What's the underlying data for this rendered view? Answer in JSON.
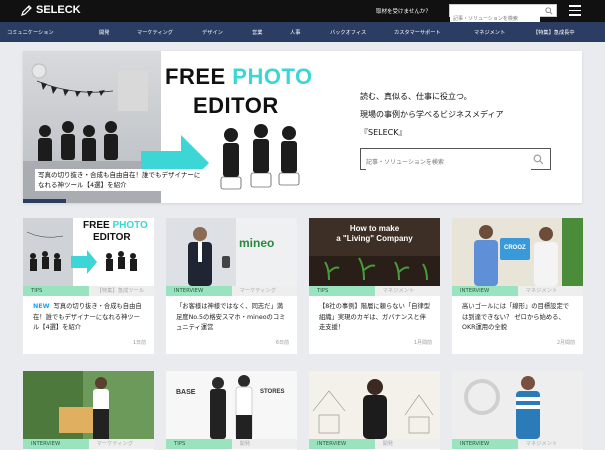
{
  "header": {
    "logo": "SELECK",
    "prompt": "取材を受けませんか？",
    "search_placeholder": "記事・ソリューションを検索"
  },
  "nav": {
    "items": [
      "コミュニケーション",
      "開発",
      "マーケティング",
      "デザイン",
      "営業",
      "人事",
      "バックオフィス",
      "カスタマーサポート",
      "マネジメント",
      "【特集】",
      "急成長中"
    ]
  },
  "hero": {
    "title_part1": "FREE ",
    "title_accent": "PHOTO",
    "title_line2": "EDITOR",
    "caption": "写真の切り抜き・合成も自由自在！誰でもデザイナーになれる神ツール【4選】を紹介",
    "tagline1": "読む、真似る、仕事に役立つ。",
    "tagline2": "現場の事例から学べるビジネスメディア",
    "tagline3": "『SELECK』",
    "search_placeholder": "記事・ソリューションを検索"
  },
  "cards_row1": [
    {
      "img_text1": "FREE ",
      "img_accent": "PHOTO",
      "img_text2": "EDITOR",
      "tag1": "TIPS",
      "tag2": "【特集】急成ツール",
      "new": "NEW",
      "title": "写真の切り抜き・合成も自由自在！誰でもデザイナーになれる神ツール【4選】を紹介",
      "date": "1日前"
    },
    {
      "img_text1": "mineo",
      "tag1": "INTERVIEW",
      "tag2": "マーケティング",
      "title": "「お客様は神様ではなく、同志だ」満足度No.5の格安スマホ・mineoのコミュニティ運営",
      "date": "6日前"
    },
    {
      "img_text1": "How to make",
      "img_text2": "a \"Living\" Company",
      "tag1": "TIPS",
      "tag2": "マネジメント",
      "title": "【8社の事例】階層に頼らない「自律型組織」実現のカギは、ガバナンスと伴走支援！",
      "date": "1月間前"
    },
    {
      "img_text1": "CROOZ",
      "tag1": "INTERVIEW",
      "tag2": "マネジメント",
      "title": "高いゴールには「線形」の目標設定では到達できない？ ゼロから始める、OKR運用の全貌",
      "date": "2月間前"
    }
  ],
  "cards_row2": [
    {
      "tag1": "INTERVIEW",
      "tag2": "マーケティング"
    },
    {
      "img_text1": "BASE",
      "img_text2": "STORES",
      "tag1": "TIPS",
      "tag2": "開発"
    },
    {
      "tag1": "INTERVIEW",
      "tag2": "開発"
    },
    {
      "tag1": "INTERVIEW",
      "tag2": "マネジメント"
    }
  ],
  "colors": {
    "header": "#111111",
    "nav": "#2c3d64",
    "accent": "#3cd6d6",
    "tag_primary": "#99e4bf"
  }
}
